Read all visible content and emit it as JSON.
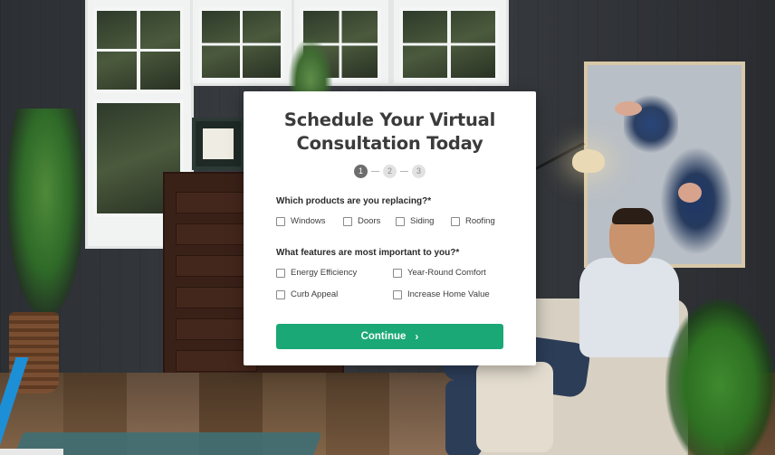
{
  "modal": {
    "title_line1": "Schedule Your Virtual",
    "title_line2": "Consultation Today",
    "steps": [
      "1",
      "2",
      "3"
    ],
    "active_step": 1,
    "question1": "Which products are you replacing?*",
    "products": [
      "Windows",
      "Doors",
      "Siding",
      "Roofing"
    ],
    "question2": "What features are most important to you?*",
    "features": [
      "Energy Efficiency",
      "Year-Round Comfort",
      "Curb Appeal",
      "Increase Home Value"
    ],
    "continue_label": "Continue",
    "continue_icon": "chevron-right-icon",
    "accent_color": "#1aa876"
  }
}
